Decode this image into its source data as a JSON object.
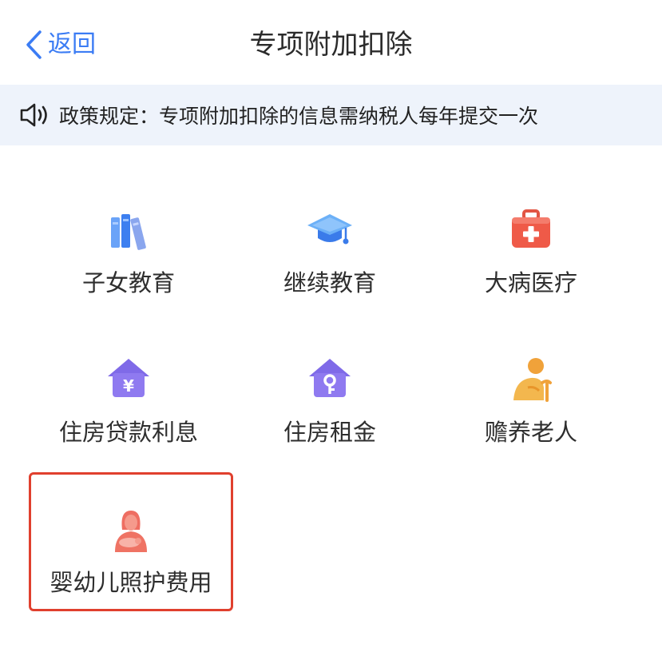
{
  "nav": {
    "back_label": "返回",
    "title": "专项附加扣除"
  },
  "notice": {
    "text": "政策规定：专项附加扣除的信息需纳税人每年提交一次"
  },
  "items": [
    {
      "label": "子女教育",
      "icon": "books-icon"
    },
    {
      "label": "继续教育",
      "icon": "graduation-cap-icon"
    },
    {
      "label": "大病医疗",
      "icon": "medical-kit-icon"
    },
    {
      "label": "住房贷款利息",
      "icon": "house-yen-icon"
    },
    {
      "label": "住房租金",
      "icon": "house-key-icon"
    },
    {
      "label": "赡养老人",
      "icon": "elderly-person-icon"
    },
    {
      "label": "婴幼儿照护费用",
      "icon": "mother-baby-icon"
    }
  ],
  "colors": {
    "accent": "#3b7cf4",
    "notice_bg": "#eef3fb",
    "highlight_border": "#e0402e"
  }
}
